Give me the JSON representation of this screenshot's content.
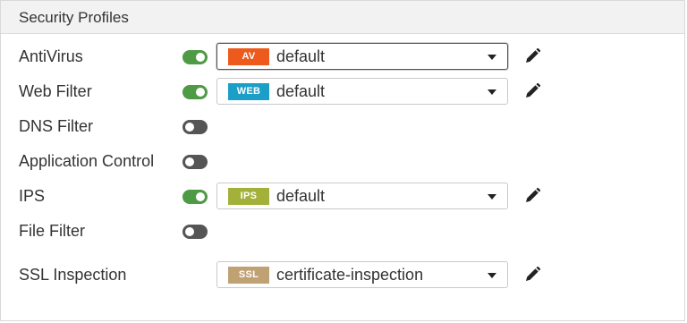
{
  "panel": {
    "title": "Security Profiles"
  },
  "rows": [
    {
      "label": "AntiVirus",
      "toggle": "on",
      "badge": "AV",
      "badge_color": "#ee5a1c",
      "value": "default",
      "focused": true
    },
    {
      "label": "Web Filter",
      "toggle": "on",
      "badge": "WEB",
      "badge_color": "#1b9fc8",
      "value": "default"
    },
    {
      "label": "DNS Filter",
      "toggle": "off"
    },
    {
      "label": "Application Control",
      "toggle": "off"
    },
    {
      "label": "IPS",
      "toggle": "on",
      "badge": "IPS",
      "badge_color": "#a3b13a",
      "value": "default"
    },
    {
      "label": "File Filter",
      "toggle": "off"
    },
    {
      "label": "SSL Inspection",
      "badge": "SSL",
      "badge_color": "#c0a173",
      "value": "certificate-inspection"
    }
  ],
  "icons": {
    "edit": "pencil-icon",
    "dropdown": "chevron-down-icon"
  },
  "colors": {
    "toggle_on": "#4e9a45",
    "toggle_off": "#555555"
  }
}
